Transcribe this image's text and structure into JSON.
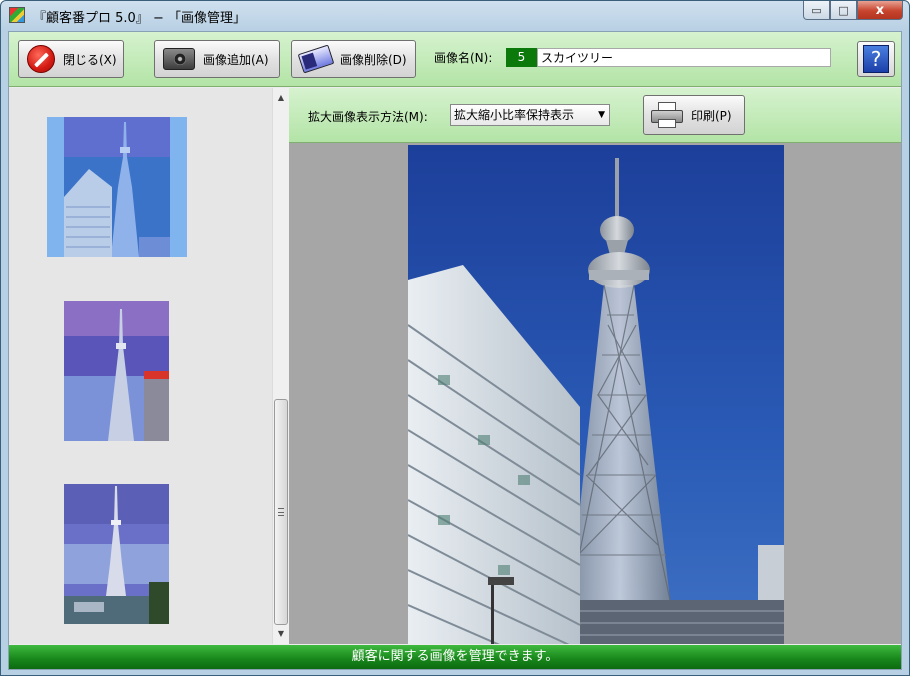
{
  "window": {
    "title": "『顧客番プロ 5.0』 − 「画像管理」",
    "controls": {
      "minimize": "▭",
      "maximize": "□",
      "close": "x"
    }
  },
  "toolbar": {
    "close_label": "閉じる(X)",
    "add_image_label": "画像追加(A)",
    "delete_image_label": "画像削除(D)",
    "image_name_label": "画像名(N):",
    "image_number": "5",
    "image_name_value": "スカイツリー",
    "help_label": "?"
  },
  "viewer": {
    "display_method_label": "拡大画像表示方法(M):",
    "display_method_value": "拡大縮小比率保持表示",
    "print_label": "印刷(P)"
  },
  "thumbnails": {
    "selected_index": 0,
    "count": 3
  },
  "scrollbar": {
    "up": "▲",
    "down": "▼"
  },
  "status": {
    "message": "顧客に関する画像を管理できます。"
  },
  "colors": {
    "toolbar_green": "#b3e4a6",
    "status_green": "#17851a",
    "number_box": "#0b7a0b",
    "selection_blue": "#7fb4ee",
    "sky_blue": "#1f4fae"
  }
}
